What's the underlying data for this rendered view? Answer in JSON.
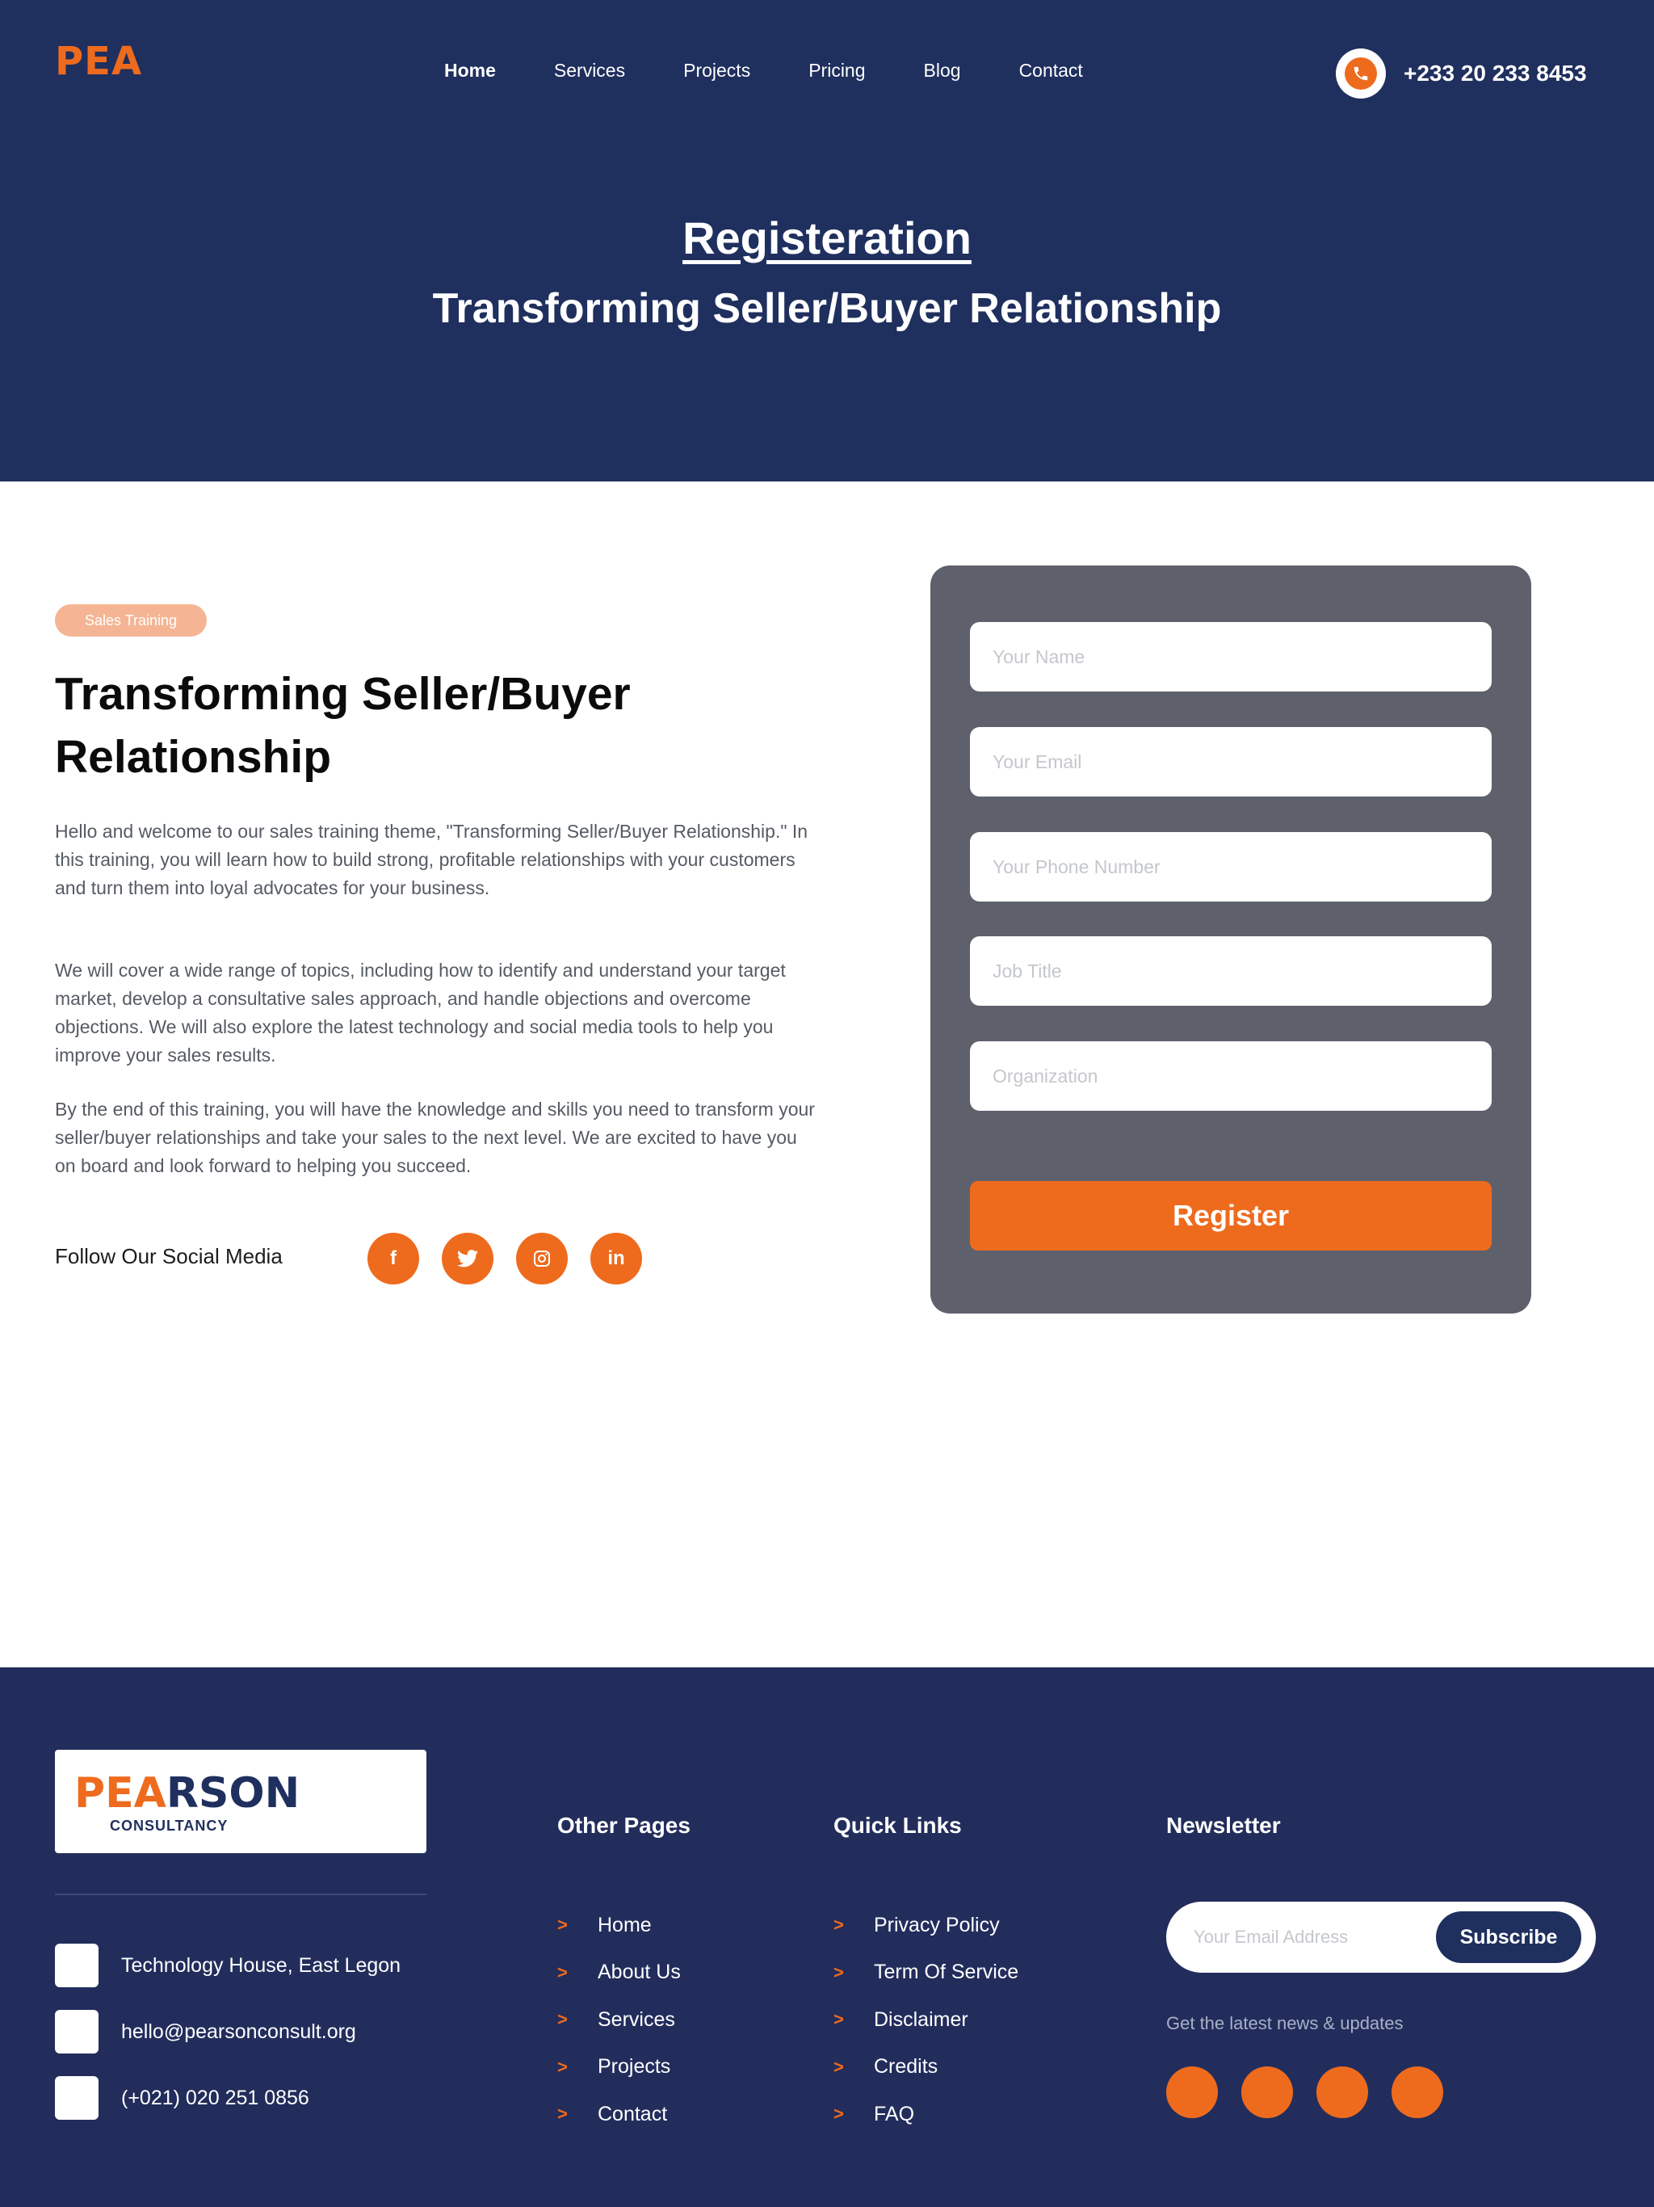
{
  "header": {
    "logo_text": "PEA",
    "nav": [
      "Home",
      "Services",
      "Projects",
      "Pricing",
      "Blog",
      "Contact"
    ],
    "phone": "+233 20 233 8453",
    "title": "Registeration",
    "subtitle": "Transforming Seller/Buyer Relationship"
  },
  "main": {
    "badge": "Sales Training",
    "title": "Transforming Seller/Buyer Relationship",
    "paragraphs": [
      "Hello and welcome to our sales training theme, \"Transforming Seller/Buyer Relationship.\" In this training, you will learn how to build strong, profitable relationships with your customers and turn them into loyal advocates for your business.",
      "We will cover a wide range of topics, including how to identify and understand your target market, develop a consultative sales approach, and handle objections and overcome objections. We will also explore the latest technology and social media tools to help you improve your sales results.",
      "By the end of this training, you will have the knowledge and skills you need to transform your seller/buyer relationships and take your sales to the next level. We are excited to have you on board and look forward to helping you succeed."
    ],
    "follow_label": "Follow Our Social Media",
    "social_icons": [
      "facebook-icon",
      "twitter-icon",
      "instagram-icon",
      "linkedin-icon"
    ]
  },
  "form": {
    "name_placeholder": "Your Name",
    "email_placeholder": "Your Email",
    "phone_placeholder": "Your Phone Number",
    "job_placeholder": "Job Title",
    "org_placeholder": "Organization",
    "submit_label": "Register"
  },
  "footer": {
    "logo_first": "PE",
    "logo_accent": "A",
    "logo_rest": "RSON",
    "logo_sub": "CONSULTANCY",
    "address": "Technology House, East Legon",
    "email": "hello@pearsonconsult.org",
    "phone": "(+021) 020 251 0856",
    "other_pages_title": "Other Pages",
    "other_pages": [
      "Home",
      "About Us",
      "Services",
      "Projects",
      "Contact"
    ],
    "quick_links_title": "Quick Links",
    "quick_links": [
      "Privacy Policy",
      "Term Of Service",
      "Disclaimer",
      "Credits",
      "FAQ"
    ],
    "newsletter_title": "Newsletter",
    "newsletter_placeholder": "Your Email Address",
    "newsletter_button": "Subscribe",
    "newsletter_caption": "Get the latest news & updates"
  },
  "colors": {
    "navy": "#1f2f5e",
    "footer_navy": "#222d5c",
    "accent_orange": "#ee6b1e",
    "form_gray": "#5e616b"
  }
}
